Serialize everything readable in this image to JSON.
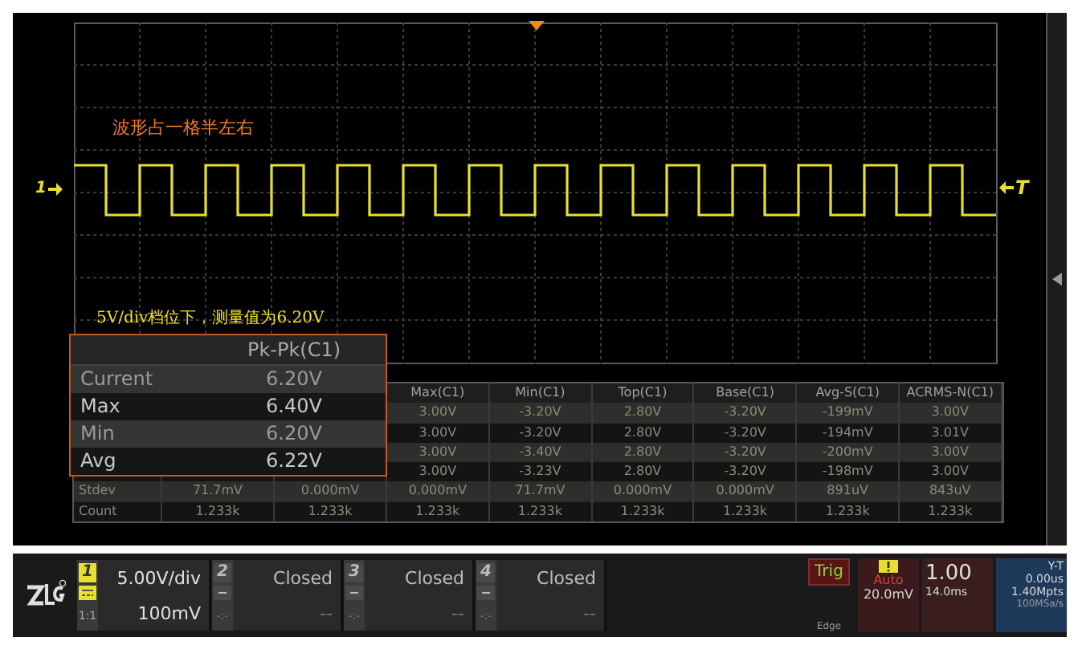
{
  "screen": {
    "annotations": [
      {
        "text": "波形占一格半左右",
        "color": "#f07a2a"
      },
      {
        "text": "5V/div档位下，测量值为6.20V",
        "color": "#f2e21a"
      }
    ],
    "channel_marker": {
      "label": "1"
    },
    "trigger_marker": {
      "label": "T"
    },
    "stat_popup": {
      "title": "Pk-Pk(C1)",
      "rows": [
        {
          "label": "Current",
          "value": "6.20V"
        },
        {
          "label": "Max",
          "value": "6.40V"
        },
        {
          "label": "Min",
          "value": "6.20V"
        },
        {
          "label": "Avg",
          "value": "6.22V"
        }
      ]
    },
    "measurements": {
      "columns": [
        "Max(C1)",
        "Min(C1)",
        "Top(C1)",
        "Base(C1)",
        "Avg-S(C1)",
        "ACRMS-N(C1)"
      ],
      "rows": [
        {
          "cells": [
            "3.00V",
            "-3.20V",
            "2.80V",
            "-3.20V",
            "-199mV",
            "3.00V"
          ]
        },
        {
          "cells": [
            "3.00V",
            "-3.20V",
            "2.80V",
            "-3.20V",
            "-194mV",
            "3.01V"
          ]
        },
        {
          "cells": [
            "3.00V",
            "-3.40V",
            "2.80V",
            "-3.20V",
            "-200mV",
            "3.00V"
          ]
        },
        {
          "cells": [
            "3.00V",
            "-3.23V",
            "2.80V",
            "-3.20V",
            "-198mV",
            "3.00V"
          ]
        },
        {
          "label": "Stdev",
          "cells": [
            "71.7mV",
            "0.000mV",
            "0.000mV",
            "71.7mV",
            "0.000mV",
            "0.000mV",
            "891uV",
            "843uV"
          ]
        },
        {
          "label": "Count",
          "cells": [
            "1.233k",
            "1.233k",
            "1.233k",
            "1.233k",
            "1.233k",
            "1.233k",
            "1.233k",
            "1.233k"
          ]
        }
      ]
    }
  },
  "channels": [
    {
      "number": "1",
      "on": true,
      "scale": "5.00V/div",
      "offset": "100mV",
      "probe": "1:1"
    },
    {
      "number": "2",
      "on": false,
      "scale": "Closed",
      "offset": "--",
      "probe": "-:-"
    },
    {
      "number": "3",
      "on": false,
      "scale": "Closed",
      "offset": "--",
      "probe": "-:-"
    },
    {
      "number": "4",
      "on": false,
      "scale": "Closed",
      "offset": "--",
      "probe": "-:-"
    }
  ],
  "trigger": {
    "label": "Trig",
    "mode": "Auto",
    "level": "20.0mV",
    "type": "Edge"
  },
  "timebase": {
    "scale": "1.00",
    "delay": "14.0ms",
    "format": "Y-T",
    "offset": "0.00us",
    "depth": "1.40Mpts",
    "rate": "100MSa/s"
  }
}
